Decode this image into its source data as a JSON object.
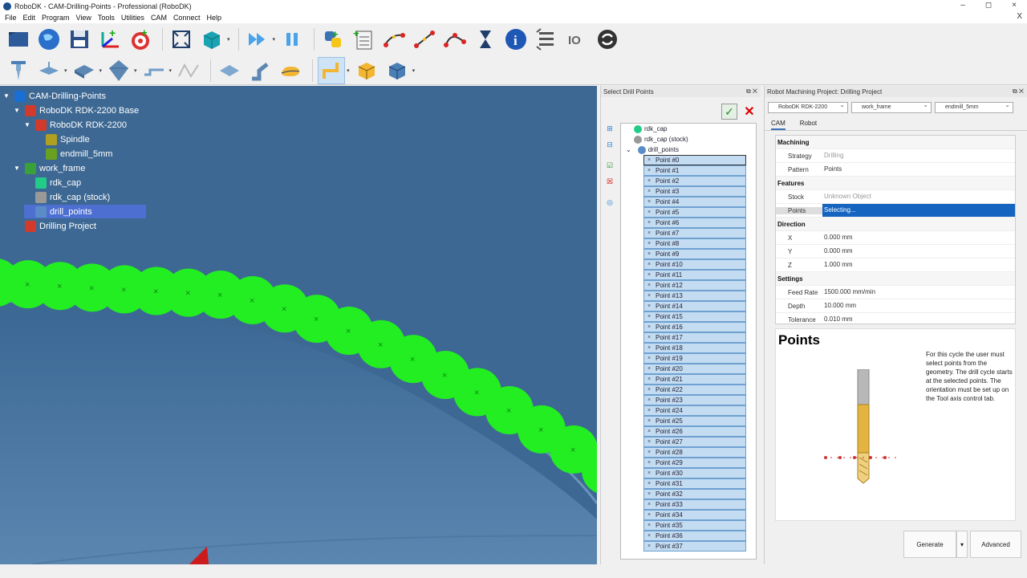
{
  "window": {
    "title": "RoboDK - CAM-Drilling-Points - Professional (RoboDK)",
    "buttons": [
      "–",
      "◻",
      "×"
    ]
  },
  "menu": [
    "File",
    "Edit",
    "Program",
    "View",
    "Tools",
    "Utilities",
    "CAM",
    "Connect",
    "Help"
  ],
  "menu_close": "X",
  "toolbar1": [
    "open-icon",
    "web-icon",
    "save-icon",
    "add-frame-icon",
    "add-target-icon",
    "fit-all-icon",
    "box-view-icon",
    "run-fast-icon",
    "pause-icon",
    "python-icon",
    "add-program-icon",
    "move-joint-icon",
    "move-linear-icon",
    "move-circular-icon",
    "pause-timer-icon",
    "info-icon",
    "instruction-list-icon",
    "io-icon",
    "refresh-icon"
  ],
  "toolbar2": [
    "drill-tool-icon",
    "plane-icon",
    "surface-icon",
    "diamond-icon",
    "curve-icon",
    "points-icon",
    "tile-icon",
    "robot-arm-icon",
    "shape-icon",
    "path-icon",
    "cube-icon",
    "box-icon"
  ],
  "tree": [
    {
      "label": "CAM-Drilling-Points",
      "indent": 0,
      "arrow": true
    },
    {
      "label": "RoboDK RDK-2200 Base",
      "indent": 1,
      "arrow": true
    },
    {
      "label": "RoboDK RDK-2200",
      "indent": 2,
      "arrow": true
    },
    {
      "label": "Spindle",
      "indent": 3,
      "arrow": false
    },
    {
      "label": "endmill_5mm",
      "indent": 3,
      "arrow": false
    },
    {
      "label": "work_frame",
      "indent": 1,
      "arrow": true
    },
    {
      "label": "rdk_cap",
      "indent": 2,
      "arrow": false
    },
    {
      "label": "rdk_cap (stock)",
      "indent": 2,
      "arrow": false
    },
    {
      "label": "drill_points",
      "indent": 2,
      "arrow": false,
      "selected": true
    },
    {
      "label": "Drilling Project",
      "indent": 1,
      "arrow": false
    }
  ],
  "drill_panel": {
    "title": "Select Drill Points",
    "ok_icon": "✓",
    "cancel_icon": "✕",
    "objects": [
      "rdk_cap",
      "rdk_cap (stock)",
      "drill_points"
    ],
    "points": [
      "Point #0",
      "Point #1",
      "Point #2",
      "Point #3",
      "Point #4",
      "Point #5",
      "Point #6",
      "Point #7",
      "Point #8",
      "Point #9",
      "Point #10",
      "Point #11",
      "Point #12",
      "Point #13",
      "Point #14",
      "Point #15",
      "Point #16",
      "Point #17",
      "Point #18",
      "Point #19",
      "Point #20",
      "Point #21",
      "Point #22",
      "Point #23",
      "Point #24",
      "Point #25",
      "Point #26",
      "Point #27",
      "Point #28",
      "Point #29",
      "Point #30",
      "Point #31",
      "Point #32",
      "Point #33",
      "Point #34",
      "Point #35",
      "Point #36",
      "Point #37"
    ]
  },
  "machining": {
    "title": "Robot Machining Project: Drilling Project",
    "robot": "RoboDK RDK-2200",
    "frame": "work_frame",
    "tool": "endmill_5mm",
    "tabs": [
      "CAM",
      "Robot"
    ],
    "sections": [
      {
        "header": "Machining",
        "rows": [
          {
            "k": "Strategy",
            "v": "Drilling",
            "dis": true
          },
          {
            "k": "Pattern",
            "v": "Points"
          }
        ]
      },
      {
        "header": "Features",
        "rows": [
          {
            "k": "Stock",
            "v": "Unknown Object",
            "dis": true
          },
          {
            "k": "Points",
            "v": "Selecting...",
            "hl": true
          }
        ]
      },
      {
        "header": "Direction",
        "rows": [
          {
            "k": "X",
            "v": "0.000 mm"
          },
          {
            "k": "Y",
            "v": "0.000 mm"
          },
          {
            "k": "Z",
            "v": "1.000 mm"
          }
        ]
      },
      {
        "header": "Settings",
        "rows": [
          {
            "k": "Feed Rate",
            "v": "1500.000 mm/min"
          },
          {
            "k": "Depth",
            "v": "10.000 mm"
          },
          {
            "k": "Tolerance",
            "v": "0.010 mm"
          }
        ]
      }
    ],
    "help_title": "Points",
    "help_text": "For this cycle the user must select points from the geometry. The drill cycle starts at the selected points. The orientation must be set up on the Tool axis control tab.",
    "generate": "Generate",
    "generate_menu": "▾",
    "advanced": "Advanced"
  },
  "colors": {
    "viewport": "#3f6a96",
    "points": "#22ee22",
    "selection": "#4d6fd1",
    "highlight": "#1565c0"
  }
}
